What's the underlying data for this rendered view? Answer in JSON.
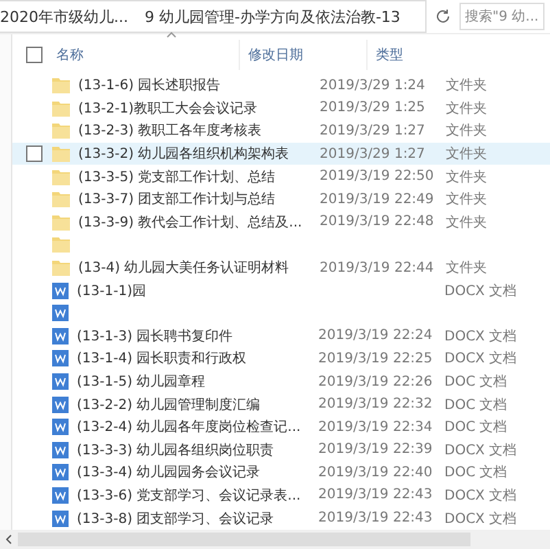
{
  "address": {
    "crumbs": [
      "2020年市级幼儿...",
      "9 幼儿园管理-办学方向及依法治教-13"
    ]
  },
  "search": {
    "placeholder": "搜索\"9 幼..."
  },
  "select_all": {
    "checked": false
  },
  "columns": [
    "名称",
    "修改日期",
    "类型"
  ],
  "rows": [
    {
      "kind": "folder",
      "name": "(13-1-6) 园长述职报告",
      "date": "2019/3/29 1:24",
      "type": "文件夹",
      "hovered": false
    },
    {
      "kind": "folder",
      "name": "(13-2-1)教职工大会会议记录",
      "date": "2019/3/29 1:25",
      "type": "文件夹",
      "hovered": false
    },
    {
      "kind": "folder",
      "name": "(13-2-3) 教职工各年度考核表",
      "date": "2019/3/29 1:27",
      "type": "文件夹",
      "hovered": false
    },
    {
      "kind": "folder",
      "name": "(13-3-2) 幼儿园各组织机构架构表",
      "date": "2019/3/29 1:27",
      "type": "文件夹",
      "hovered": true
    },
    {
      "kind": "folder",
      "name": "(13-3-5) 党支部工作计划、总结",
      "date": "2019/3/19 22:50",
      "type": "文件夹",
      "hovered": false
    },
    {
      "kind": "folder",
      "name": "(13-3-7) 团支部工作计划与总结",
      "date": "2019/3/19 22:49",
      "type": "文件夹",
      "hovered": false
    },
    {
      "kind": "folder",
      "name": "(13-3-9) 教代会工作计划、总结及...",
      "date": "2019/3/19 22:48",
      "type": "文件夹",
      "hovered": false
    },
    {
      "kind": "folder",
      "hovered": false
    },
    {
      "kind": "folder",
      "name": "(13-4) 幼儿园大美任务认证明材料",
      "date": "2019/3/19 22:44",
      "type": "文件夹",
      "hovered": false
    },
    {
      "kind": "doc",
      "name": "(13-1-1)园",
      "type": "DOCX 文档",
      "hovered": false
    },
    {
      "kind": "doc",
      "hovered": false
    },
    {
      "kind": "doc",
      "name": "(13-1-3) 园长聘书复印件",
      "date": "2019/3/19 22:24",
      "type": "DOCX 文档",
      "hovered": false
    },
    {
      "kind": "doc",
      "name": "(13-1-4) 园长职责和行政权",
      "date": "2019/3/19 22:25",
      "type": "DOCX 文档",
      "hovered": false
    },
    {
      "kind": "doc",
      "name": "(13-1-5) 幼儿园章程",
      "date": "2019/3/19 22:26",
      "type": "DOC 文档",
      "hovered": false
    },
    {
      "kind": "doc",
      "name": "(13-2-2) 幼儿园管理制度汇编",
      "date": "2019/3/19 22:32",
      "type": "DOC 文档",
      "hovered": false
    },
    {
      "kind": "doc",
      "name": "(13-2-4) 幼儿园各年度岗位检查记...",
      "date": "2019/3/19 22:34",
      "type": "DOC 文档",
      "hovered": false
    },
    {
      "kind": "doc",
      "name": "(13-3-3) 幼儿园各组织岗位职责",
      "date": "2019/3/19 22:39",
      "type": "DOCX 文档",
      "hovered": false
    },
    {
      "kind": "doc",
      "name": "(13-3-4) 幼儿园园务会议记录",
      "date": "2019/3/19 22:40",
      "type": "DOC 文档",
      "hovered": false
    },
    {
      "kind": "doc",
      "name": "(13-3-6) 党支部学习、会议记录表...",
      "date": "2019/3/19 22:43",
      "type": "DOCX 文档",
      "hovered": false
    },
    {
      "kind": "doc",
      "name": "(13-3-8) 团支部学习、会议记录",
      "date": "2019/3/19 22:43",
      "type": "DOCX 文档",
      "hovered": false
    }
  ]
}
